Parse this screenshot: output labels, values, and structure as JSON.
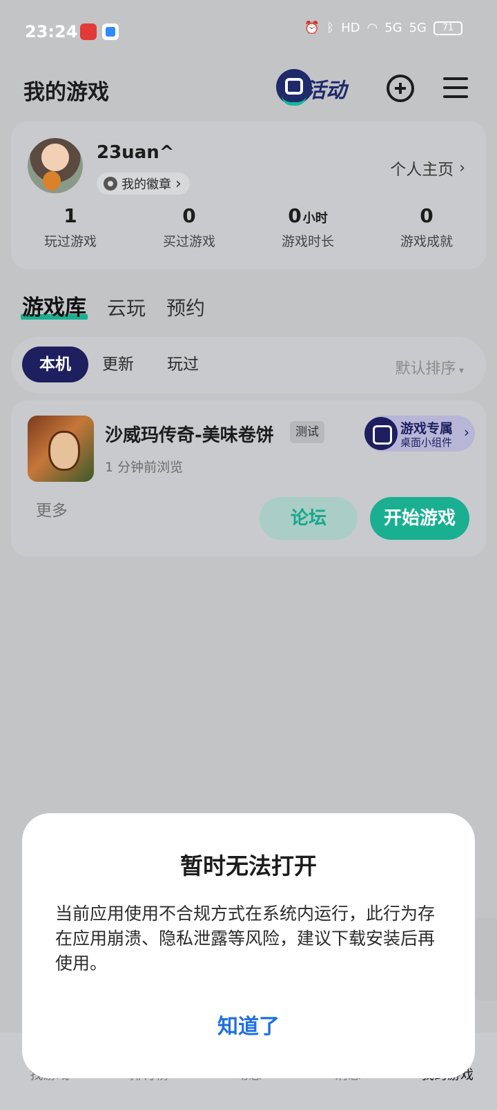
{
  "status_bar": {
    "time": "23:24",
    "icons": [
      "alarm-icon",
      "bluetooth-icon",
      "hd-icon",
      "wifi-icon",
      "5g-signal-icon",
      "5g-signal-icon"
    ],
    "hd": "HD",
    "net1": "5G",
    "net2": "5G",
    "battery": "71"
  },
  "header": {
    "title": "我的游戏",
    "activity_label": "活动"
  },
  "profile": {
    "username": "23uan^",
    "badge_label": "我的徽章",
    "homepage_label": "个人主页",
    "stats": [
      {
        "value": "1",
        "unit": "",
        "label": "玩过游戏"
      },
      {
        "value": "0",
        "unit": "",
        "label": "买过游戏"
      },
      {
        "value": "0",
        "unit": "小时",
        "label": "游戏时长"
      },
      {
        "value": "0",
        "unit": "",
        "label": "游戏成就"
      }
    ]
  },
  "library_tabs": [
    "游戏库",
    "云玩",
    "预约"
  ],
  "filter": {
    "chips": [
      "本机",
      "更新",
      "玩过"
    ],
    "sort_label": "默认排序"
  },
  "game": {
    "title": "沙威玛传奇-美味卷饼",
    "tag": "测试",
    "subtitle": "1 分钟前浏览",
    "widget_title": "游戏专属",
    "widget_subtitle": "桌面小组件",
    "more_label": "更多",
    "forum_label": "论坛",
    "play_label": "开始游戏"
  },
  "bottom_nav": [
    "找游戏",
    "排行榜",
    "动态",
    "消息",
    "我的游戏"
  ],
  "dialog": {
    "title": "暂时无法打开",
    "body": "当前应用使用不合规方式在系统内运行，此行为存在应用崩溃、隐私泄露等风险，建议下载安装后再使用。",
    "ok_label": "知道了"
  },
  "colors": {
    "accent_green": "#1aaf91",
    "navy": "#1d1f5e",
    "link_blue": "#1e6fe0",
    "overlay_bg": "#c3c4c6"
  }
}
